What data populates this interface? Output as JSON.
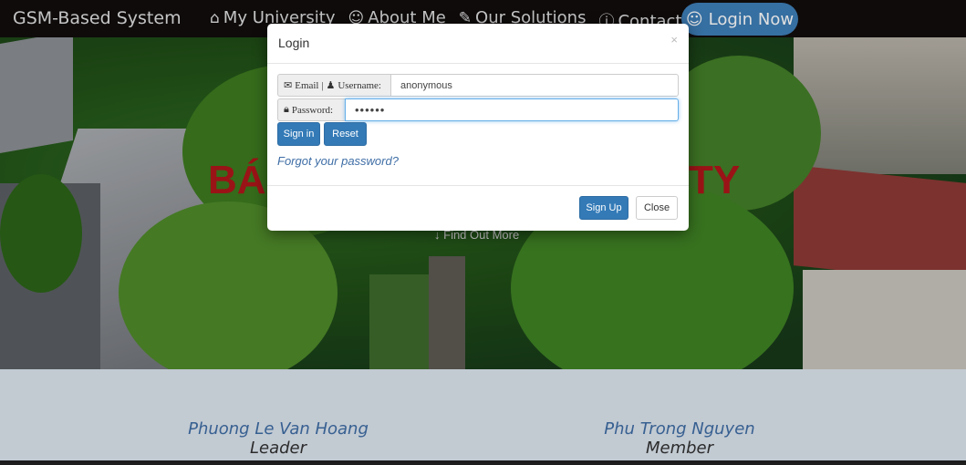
{
  "navbar": {
    "brand": "GSM-Based System",
    "links": [
      {
        "icon": "home-icon",
        "glyph": "⌂",
        "label": "My University"
      },
      {
        "icon": "user-icon",
        "glyph": "☺",
        "label": "About Me"
      },
      {
        "icon": "wrench-icon",
        "glyph": "✎",
        "label": "Our Solutions"
      },
      {
        "icon": "info-icon",
        "glyph": "ⓘ",
        "label": "Contact"
      }
    ],
    "login_button": {
      "icon": "smiley-icon",
      "glyph": "☺",
      "label": "Login Now",
      "color": "#3e7fb8"
    }
  },
  "hero": {
    "title_left": "BÁ",
    "title_right": "TY",
    "find_out_more": "Find Out More",
    "title_color": "#b0161a"
  },
  "login_modal": {
    "title": "Login",
    "close_glyph": "×",
    "email_label": "Email | ",
    "username_label": "Username:",
    "email_value": "anonymous",
    "password_label": "Password:",
    "password_value": "••••••",
    "sign_in": "Sign in",
    "reset": "Reset",
    "forgot": "Forgot your password?",
    "sign_up": "Sign Up",
    "close": "Close"
  },
  "team": {
    "members": [
      {
        "name": "Phuong Le Van Hoang",
        "role": "Leader"
      },
      {
        "name": "Phu Trong Nguyen",
        "role": "Member"
      }
    ]
  }
}
